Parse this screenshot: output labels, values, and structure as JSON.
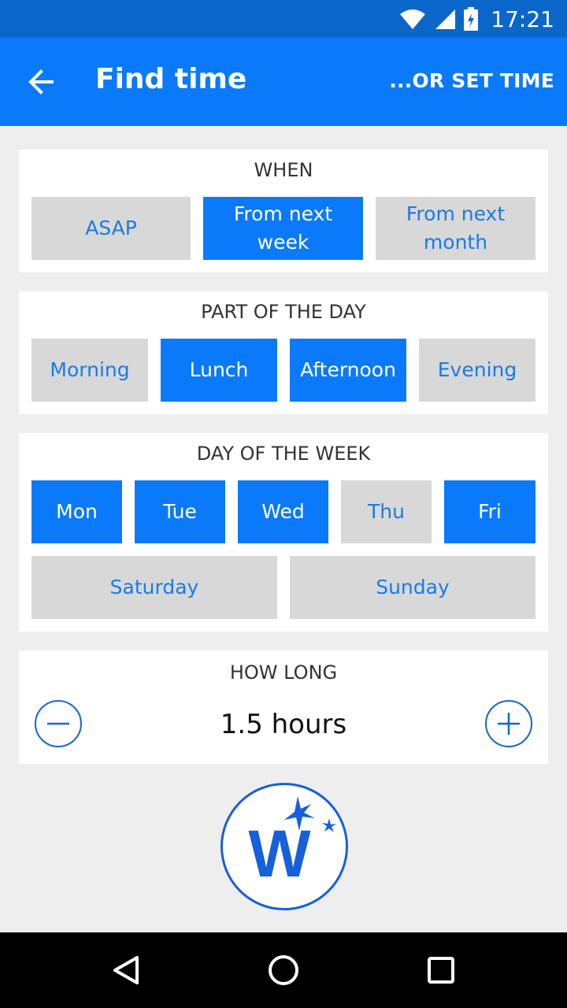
{
  "status_bar": {
    "time": "17:21",
    "icons": [
      "wifi-icon",
      "cell-signal-icon",
      "battery-icon"
    ]
  },
  "app_bar": {
    "title": "Find time",
    "set_time_label": "...OR SET TIME",
    "back_icon": "arrow-left-icon"
  },
  "when": {
    "title": "WHEN",
    "options": [
      {
        "label": "ASAP",
        "selected": false
      },
      {
        "label": "From next week",
        "selected": true
      },
      {
        "label": "From next month",
        "selected": false
      }
    ]
  },
  "part_of_day": {
    "title": "PART OF THE DAY",
    "options": [
      {
        "label": "Morning",
        "selected": false
      },
      {
        "label": "Lunch",
        "selected": true
      },
      {
        "label": "Afternoon",
        "selected": true
      },
      {
        "label": "Evening",
        "selected": false
      }
    ]
  },
  "day_of_week": {
    "title": "DAY OF THE WEEK",
    "options": [
      {
        "label": "Mon",
        "selected": true
      },
      {
        "label": "Tue",
        "selected": true
      },
      {
        "label": "Wed",
        "selected": true
      },
      {
        "label": "Thu",
        "selected": false
      },
      {
        "label": "Fri",
        "selected": true
      },
      {
        "label": "Saturday",
        "selected": false
      },
      {
        "label": "Sunday",
        "selected": false
      }
    ]
  },
  "how_long": {
    "title": "HOW LONG",
    "value": "1.5 hours",
    "decrease_icon": "minus-circle-icon",
    "increase_icon": "plus-circle-icon"
  },
  "logo": {
    "icon": "w-sparkle-logo",
    "letter": "W"
  },
  "nav": {
    "icons": [
      "back-triangle-icon",
      "home-circle-icon",
      "recents-square-icon"
    ]
  },
  "colors": {
    "primary": "#0a7afa",
    "status_bar": "#0a67c9",
    "unselected_bg": "#d8d8d8",
    "unselected_text": "#1a7ae8",
    "background": "#eeeeee"
  }
}
